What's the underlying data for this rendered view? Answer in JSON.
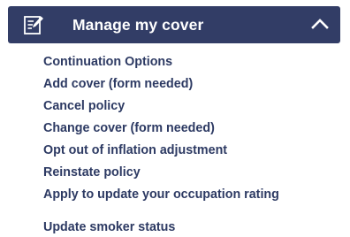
{
  "menu": {
    "title": "Manage my cover",
    "expanded": true,
    "header_icon": "document-edit-icon",
    "toggle_icon": "chevron-up-icon",
    "colors": {
      "header_background": "#323d66",
      "header_text": "#ffffff",
      "link_text": "#2d3a63"
    },
    "items": [
      {
        "label": "Continuation Options"
      },
      {
        "label": "Add cover (form needed)"
      },
      {
        "label": "Cancel policy"
      },
      {
        "label": "Change cover (form needed)"
      },
      {
        "label": "Opt out of inflation adjustment"
      },
      {
        "label": "Reinstate policy"
      },
      {
        "label": "Apply to update your occupation rating"
      },
      {
        "label": "Update smoker status"
      }
    ]
  }
}
